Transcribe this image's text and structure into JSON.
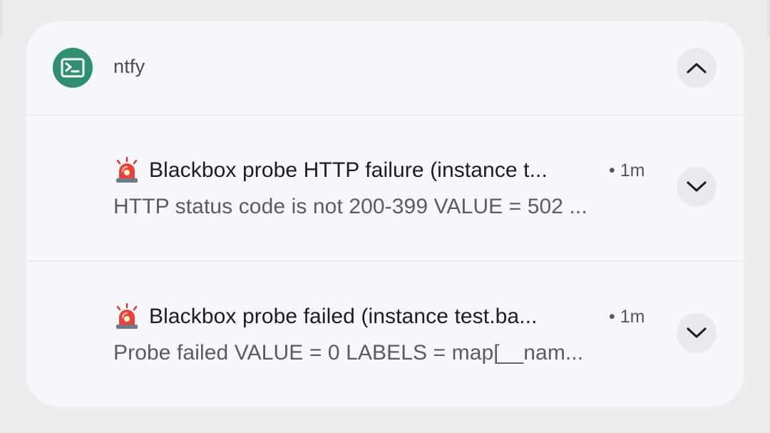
{
  "group": {
    "app_name": "ntfy",
    "app_icon": "terminal-icon",
    "app_color": "#2f8f6f",
    "collapse_icon": "chevron-up-icon"
  },
  "notifications": [
    {
      "icon": "police-light-icon",
      "title": "Blackbox probe HTTP failure (instance t...",
      "time": "• 1m",
      "body": "HTTP status code is not 200-399   VALUE = 502  ...",
      "expand_icon": "chevron-down-icon"
    },
    {
      "icon": "police-light-icon",
      "title": "Blackbox probe failed (instance test.ba...",
      "time": "• 1m",
      "body": "Probe failed   VALUE = 0   LABELS = map[__nam...",
      "expand_icon": "chevron-down-icon"
    }
  ]
}
